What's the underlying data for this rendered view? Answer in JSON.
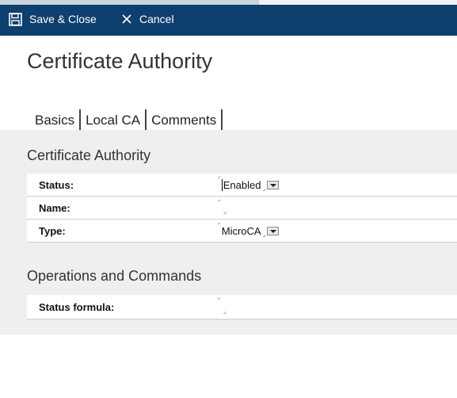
{
  "toolbar": {
    "save_label": "Save & Close",
    "cancel_label": "Cancel",
    "save_icon": "floppy-disk-icon",
    "cancel_icon": "close-icon",
    "bar_color": "#0d3f6f"
  },
  "page": {
    "title": "Certificate Authority"
  },
  "tabs": [
    {
      "label": "Basics",
      "active": true
    },
    {
      "label": "Local CA",
      "active": false
    },
    {
      "label": "Comments",
      "active": false
    }
  ],
  "sections": {
    "certificate_authority": {
      "title": "Certificate Authority",
      "fields": [
        {
          "label": "Status:",
          "value": "Enabled",
          "type": "dropdown"
        },
        {
          "label": "Name:",
          "value": "",
          "type": "text"
        },
        {
          "label": "Type:",
          "value": "MicroCA",
          "type": "dropdown"
        }
      ]
    },
    "operations": {
      "title": "Operations and Commands",
      "fields": [
        {
          "label": "Status formula:",
          "value": "",
          "type": "text"
        }
      ]
    }
  },
  "field_markers": {
    "open": "⌜",
    "close": "⌟"
  }
}
